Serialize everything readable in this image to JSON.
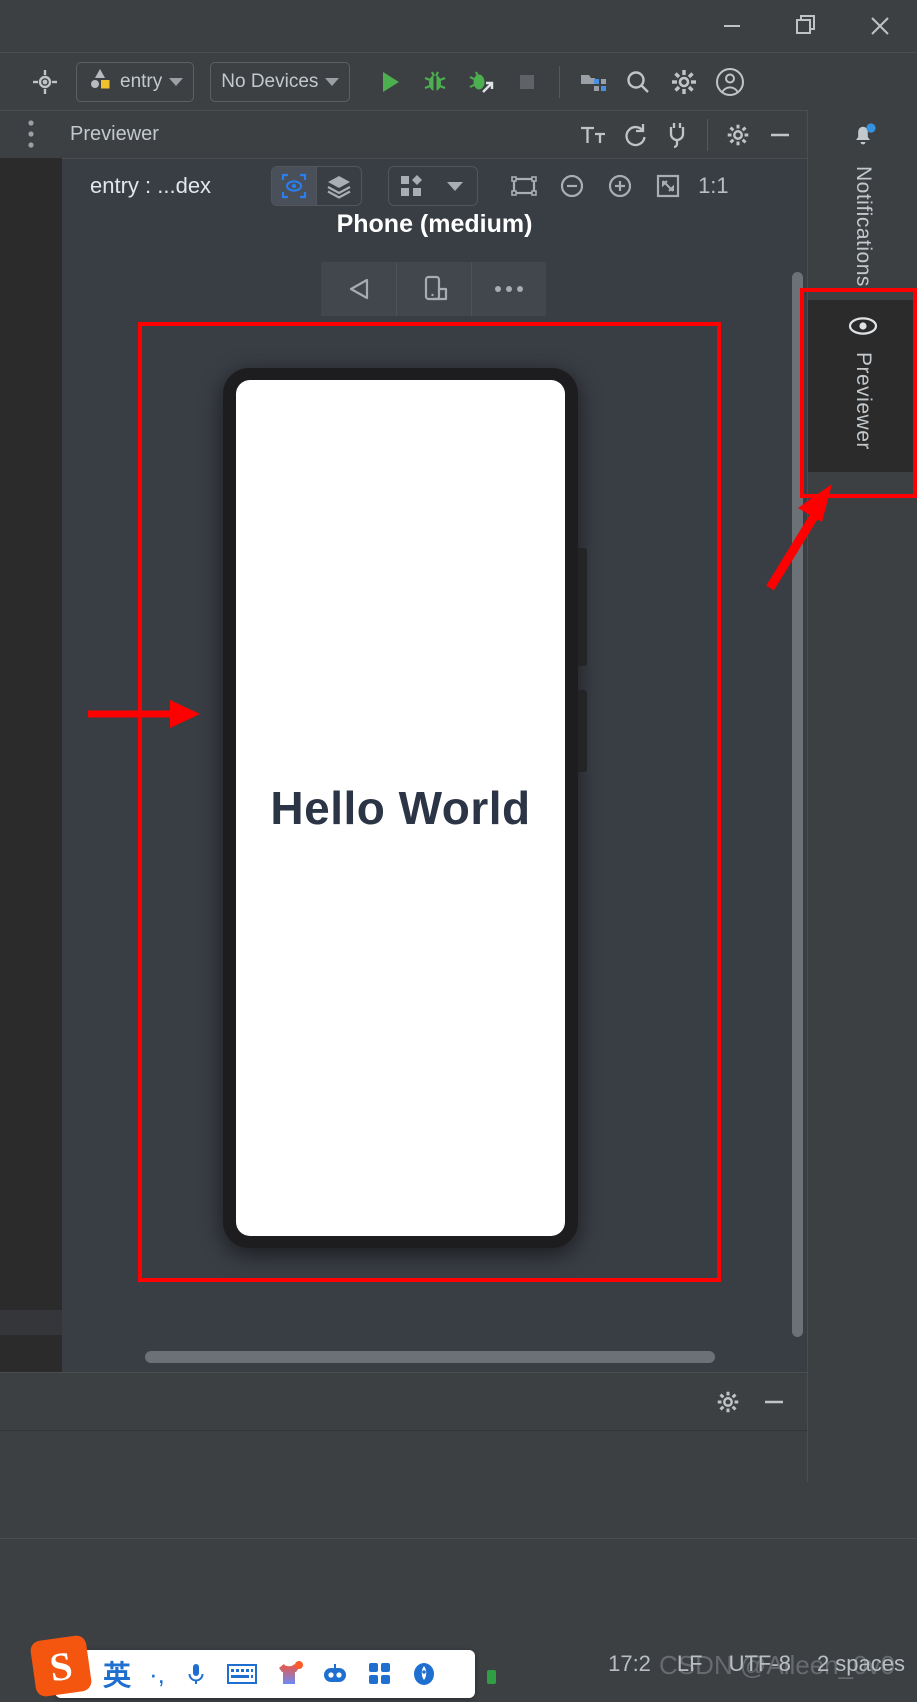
{
  "window": {
    "controls": [
      {
        "name": "minimize-button",
        "glyph": "minimize"
      },
      {
        "name": "restore-button",
        "glyph": "restore"
      },
      {
        "name": "close-button",
        "glyph": "close"
      }
    ]
  },
  "ide_toolbar": {
    "target_button": {
      "label": "entry",
      "icon": "app-module-icon"
    },
    "device_button": {
      "label": "No Devices",
      "icon": "chevron-down-icon"
    },
    "actions": [
      {
        "name": "run-button",
        "tooltip": "Run"
      },
      {
        "name": "debug-button",
        "tooltip": "Debug"
      },
      {
        "name": "attach-debugger-button",
        "tooltip": "Attach Debugger to Process"
      },
      {
        "name": "stop-button",
        "tooltip": "Stop"
      },
      {
        "name": "project-structure-button",
        "tooltip": "Project Structure"
      },
      {
        "name": "search-everywhere-button",
        "tooltip": "Search Everywhere"
      },
      {
        "name": "settings-button",
        "tooltip": "Settings"
      },
      {
        "name": "account-button",
        "tooltip": "Account"
      }
    ]
  },
  "previewer": {
    "title": "Previewer",
    "header_actions": [
      {
        "name": "text-size-button",
        "label": "Tт"
      },
      {
        "name": "refresh-button",
        "label": "refresh"
      },
      {
        "name": "plug-button",
        "label": "connect"
      },
      {
        "name": "settings-button",
        "label": "settings"
      },
      {
        "name": "hide-button",
        "label": "hide"
      }
    ],
    "file_label": "entry : ...dex",
    "status_icon": "green-check-icon",
    "view_modes": [
      {
        "name": "preview-mode-button",
        "icon": "eye-focus-icon",
        "active": true
      },
      {
        "name": "layers-mode-button",
        "icon": "layers-icon",
        "active": false
      }
    ],
    "layout_dropdown": {
      "icon": "grid-icon",
      "caret": "chevron-down-icon"
    },
    "zoom_actions": [
      {
        "name": "fit-to-window-button",
        "icon": "frame-icon"
      },
      {
        "name": "zoom-out-button",
        "icon": "zoom-out-icon"
      },
      {
        "name": "zoom-in-button",
        "icon": "zoom-in-icon"
      },
      {
        "name": "actual-device-button",
        "icon": "device-frame-icon"
      }
    ],
    "zoom_ratio": "1:1"
  },
  "canvas": {
    "device_label": "Phone (medium)",
    "device_actions": [
      {
        "name": "rotate-device-button",
        "icon": "triangle-left-icon"
      },
      {
        "name": "toggle-orientation-button",
        "icon": "phone-rotate-icon"
      },
      {
        "name": "more-options-button",
        "icon": "ellipsis-icon"
      }
    ],
    "phone_screen_text": "Hello World"
  },
  "right_stripe": {
    "items": [
      {
        "name": "sidebar-item-notifications",
        "label": "Notifications",
        "icon": "bell-icon",
        "badge": true,
        "active": false
      },
      {
        "name": "sidebar-item-previewer",
        "label": "Previewer",
        "icon": "eye-icon",
        "badge": false,
        "active": true
      }
    ]
  },
  "lower_panel": {
    "actions": [
      {
        "name": "settings-button",
        "icon": "gear-icon"
      },
      {
        "name": "hide-button",
        "icon": "minus-icon"
      }
    ]
  },
  "statusbar": {
    "caret_position": "17:2",
    "line_separator": "LF",
    "encoding": "UTF-8",
    "indent": "2 spaces",
    "watermark": "CSDN @Aileen_0v0"
  },
  "ime": {
    "logo": "S",
    "items": [
      {
        "name": "ime-language-toggle",
        "label": "英"
      },
      {
        "name": "ime-punctuation-toggle",
        "label": "·,"
      },
      {
        "name": "ime-voice-input",
        "label": "mic-icon"
      },
      {
        "name": "ime-keyboard",
        "label": "keyboard-icon"
      },
      {
        "name": "ime-skin",
        "label": "shirt-icon"
      },
      {
        "name": "ime-bot",
        "label": "robot-icon"
      },
      {
        "name": "ime-toolbox",
        "label": "grid-icon"
      },
      {
        "name": "ime-more",
        "label": "rocket-icon"
      }
    ]
  },
  "annotations": {
    "accent": "#fe0000",
    "highlight_preview_area": true,
    "highlight_previewer_tab": true
  }
}
